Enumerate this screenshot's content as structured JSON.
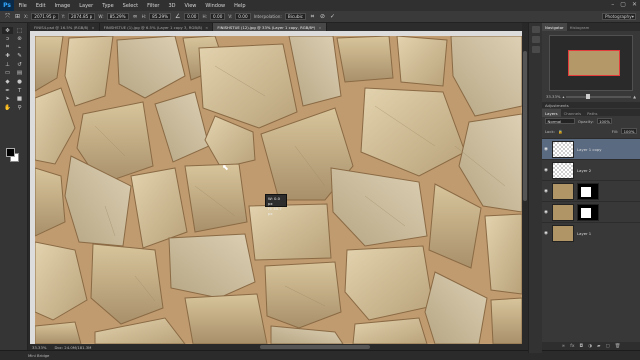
{
  "app": {
    "logo": "Ps"
  },
  "menu": [
    "File",
    "Edit",
    "Image",
    "Layer",
    "Type",
    "Select",
    "Filter",
    "3D",
    "View",
    "Window",
    "Help"
  ],
  "window_controls": [
    "–",
    "▢",
    "✕"
  ],
  "options": {
    "x_label": "X:",
    "x_value": "2071.95 p",
    "y_label": "Y:",
    "y_value": "2074.85 p",
    "w_label": "W:",
    "w_value": "85.29%",
    "h_label": "H:",
    "h_value": "85.29%",
    "angle_value": "0.00",
    "h2_label": "H:",
    "h2_value": "0.00",
    "v_label": "V:",
    "v_value": "0.00",
    "interp_label": "Interpolation:",
    "interp_value": "Bicubic",
    "workspace": "Photography"
  },
  "tabs": [
    {
      "label": "FINIS4.psd @ 16.5% (RGB/8)",
      "active": false
    },
    {
      "label": "FINISHSTUE (1).jpg @ 6.5% (Layer 1 copy 3, RGB/8)",
      "active": false
    },
    {
      "label": "FINISHSTUE (12).jpg @ 33% (Layer 1 copy, RGB/8*)",
      "active": true
    }
  ],
  "hud": {
    "line1": "W: 0.0 px",
    "line2": "H: 40.7 px"
  },
  "status": {
    "zoom": "33.33%",
    "doc": "Doc: 24.0M/181.3M"
  },
  "timeline": {
    "label": "Mini Bridge"
  },
  "navigator": {
    "tabs": [
      "Navigator",
      "Histogram"
    ],
    "zoom": "33.33%"
  },
  "adjustments": {
    "label": "Adjustments"
  },
  "layers_panel": {
    "tabs": [
      "Layers",
      "Channels",
      "Paths"
    ],
    "blend_mode": "Normal",
    "opacity_label": "Opacity:",
    "opacity": "100%",
    "lock_label": "Lock:",
    "fill_label": "Fill:",
    "fill": "100%",
    "layers": [
      {
        "name": "Layer 1 copy",
        "thumb": "checker",
        "mask": false,
        "selected": true
      },
      {
        "name": "Layer 2",
        "thumb": "checker",
        "mask": false,
        "selected": false
      },
      {
        "name": "",
        "thumb": "stone",
        "mask": true,
        "selected": false
      },
      {
        "name": "",
        "thumb": "stone",
        "mask": true,
        "selected": false
      },
      {
        "name": "Layer 1",
        "thumb": "stone",
        "mask": false,
        "selected": false
      }
    ],
    "footer_icons": [
      "link-icon",
      "fx-icon",
      "mask-icon",
      "adjust-icon",
      "folder-icon",
      "new-layer-icon",
      "trash-icon"
    ]
  },
  "colors": {
    "accent": "#5a6a80",
    "ui_dark": "#282828",
    "canvas_grout": "#c4a27a"
  },
  "tools": [
    "move-icon",
    "marquee-icon",
    "lasso-icon",
    "quick-select-icon",
    "crop-icon",
    "eyedropper-icon",
    "heal-icon",
    "brush-icon",
    "stamp-icon",
    "history-brush-icon",
    "eraser-icon",
    "gradient-icon",
    "blur-icon",
    "dodge-icon",
    "pen-icon",
    "type-icon",
    "path-select-icon",
    "shape-icon",
    "hand-icon",
    "zoom-icon"
  ]
}
